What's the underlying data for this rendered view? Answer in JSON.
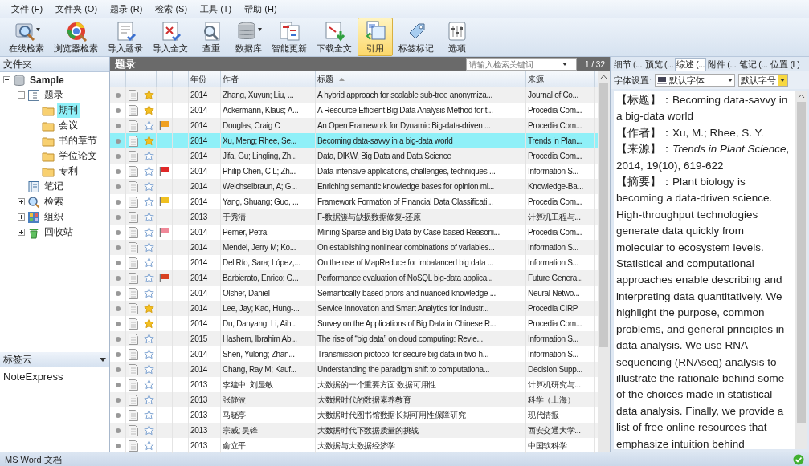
{
  "menu": [
    "文件 (F)",
    "文件夹 (O)",
    "题录 (R)",
    "检索 (S)",
    "工具 (T)",
    "帮助 (H)"
  ],
  "toolbar": [
    {
      "label": "在线检索",
      "has_menu": true,
      "selected": false
    },
    {
      "label": "浏览器检索",
      "has_menu": false,
      "selected": false
    },
    {
      "label": "导入题录",
      "has_menu": false,
      "selected": false
    },
    {
      "label": "导入全文",
      "has_menu": false,
      "selected": false
    },
    {
      "label": "查重",
      "has_menu": false,
      "selected": false
    },
    {
      "label": "数据库",
      "has_menu": true,
      "selected": false
    },
    {
      "label": "智能更新",
      "has_menu": false,
      "selected": false
    },
    {
      "label": "下载全文",
      "has_menu": false,
      "selected": false
    },
    {
      "label": "引用",
      "has_menu": false,
      "selected": true
    },
    {
      "label": "标签标记",
      "has_menu": false,
      "selected": false
    },
    {
      "label": "选项",
      "has_menu": false,
      "selected": false
    }
  ],
  "folders": {
    "title": "文件夹",
    "tree": [
      {
        "label": "Sample",
        "kind": "library",
        "expanded": true,
        "selected": false,
        "children": [
          {
            "label": "题录",
            "kind": "records",
            "expanded": true,
            "selected": false,
            "children": [
              {
                "label": "期刊",
                "kind": "folder",
                "selected": true
              },
              {
                "label": "会议",
                "kind": "folder",
                "selected": false
              },
              {
                "label": "书的章节",
                "kind": "folder",
                "selected": false
              },
              {
                "label": "学位论文",
                "kind": "folder",
                "selected": false
              },
              {
                "label": "专利",
                "kind": "folder",
                "selected": false
              }
            ]
          },
          {
            "label": "笔记",
            "kind": "notes",
            "selected": false
          },
          {
            "label": "检索",
            "kind": "search",
            "expanded": false,
            "selected": false
          },
          {
            "label": "组织",
            "kind": "organize",
            "expanded": false,
            "selected": false
          },
          {
            "label": "回收站",
            "kind": "trash",
            "expanded": false,
            "selected": false
          }
        ]
      }
    ]
  },
  "tag_cloud": {
    "title": "标签云",
    "tags": [
      "NoteExpress"
    ]
  },
  "records": {
    "title": "题录",
    "search": {
      "placeholder": "请输入检索关键词"
    },
    "counter": "1 / 32",
    "columns": [
      {
        "label": "年份",
        "sorted": false
      },
      {
        "label": "作者",
        "sorted": false
      },
      {
        "label": "标题",
        "sorted": true
      },
      {
        "label": "来源",
        "sorted": false
      }
    ],
    "rows": [
      {
        "year": "2014",
        "author": "Zhang, Xuyun; Liu, ...",
        "title": "A hybrid approach for scalable sub-tree anonymiza...",
        "source": "Journal of Co...",
        "starred": true,
        "selected": false
      },
      {
        "year": "2014",
        "author": "Ackermann, Klaus; A...",
        "title": "A Resource Efficient Big Data Analysis Method for t...",
        "source": "Procedia Com...",
        "starred": true,
        "selected": false
      },
      {
        "year": "2014",
        "author": "Douglas, Craig C",
        "title": "An Open Framework for Dynamic Big-data-driven ...",
        "source": "Procedia Com...",
        "starred": false,
        "selected": false,
        "color": "#f0a020"
      },
      {
        "year": "2014",
        "author": "Xu, Meng; Rhee, Se...",
        "title": "Becoming data-savvy in a big-data world",
        "source": "Trends in Plan...",
        "starred": true,
        "selected": true
      },
      {
        "year": "2014",
        "author": "Jifa, Gu; Lingling, Zh...",
        "title": "Data, DIKW, Big Data and Data Science",
        "source": "Procedia Com...",
        "starred": false,
        "selected": false
      },
      {
        "year": "2014",
        "author": "Philip Chen, C L; Zh...",
        "title": "Data-intensive applications, challenges, techniques ...",
        "source": "Information S...",
        "starred": false,
        "selected": false,
        "color": "#e02828"
      },
      {
        "year": "2014",
        "author": "Weichselbraun, A; G...",
        "title": "Enriching semantic knowledge bases for opinion mi...",
        "source": "Knowledge-Ba...",
        "starred": false,
        "selected": false
      },
      {
        "year": "2014",
        "author": "Yang, Shuang; Guo, ...",
        "title": "Framework Formation of Financial Data Classificati...",
        "source": "Procedia Com...",
        "starred": false,
        "selected": false,
        "color": "#f0c020"
      },
      {
        "year": "2013",
        "author": "于秀清",
        "title": "F-数据簇与缺损数据修复-还原",
        "source": "计算机工程与...",
        "starred": false,
        "selected": false
      },
      {
        "year": "2014",
        "author": "Perner, Petra",
        "title": "Mining Sparse and Big Data by Case-based Reasoni...",
        "source": "Procedia Com...",
        "starred": false,
        "selected": false,
        "color": "#f08898"
      },
      {
        "year": "2014",
        "author": "Mendel, Jerry M; Ko...",
        "title": "On establishing nonlinear combinations of variables...",
        "source": "Information S...",
        "starred": false,
        "selected": false
      },
      {
        "year": "2014",
        "author": "Del Río, Sara; López,...",
        "title": "On the use of MapReduce for imbalanced big data ...",
        "source": "Information S...",
        "starred": false,
        "selected": false
      },
      {
        "year": "2014",
        "author": "Barbierato, Enrico; G...",
        "title": "Performance evaluation of NoSQL big-data applica...",
        "source": "Future Genera...",
        "starred": false,
        "selected": false,
        "color": "#d84020"
      },
      {
        "year": "2014",
        "author": "Olsher, Daniel",
        "title": "Semantically-based priors and nuanced knowledge ...",
        "source": "Neural Netwo...",
        "starred": false,
        "selected": false
      },
      {
        "year": "2014",
        "author": "Lee, Jay; Kao, Hung-...",
        "title": "Service Innovation and Smart Analytics for Industr...",
        "source": "Procedia CIRP",
        "starred": true,
        "selected": false
      },
      {
        "year": "2014",
        "author": "Du, Danyang; Li, Aih...",
        "title": "Survey on the Applications of Big Data in Chinese R...",
        "source": "Procedia Com...",
        "starred": true,
        "selected": false
      },
      {
        "year": "2015",
        "author": "Hashem, Ibrahim Ab...",
        "title": "The rise of “big data” on cloud computing: Revie...",
        "source": "Information S...",
        "starred": false,
        "selected": false
      },
      {
        "year": "2014",
        "author": "Shen, Yulong; Zhan...",
        "title": "Transmission protocol for secure big data in two-h...",
        "source": "Information S...",
        "starred": false,
        "selected": false
      },
      {
        "year": "2014",
        "author": "Chang, Ray M; Kauf...",
        "title": "Understanding the paradigm shift to computationa...",
        "source": "Decision Supp...",
        "starred": false,
        "selected": false
      },
      {
        "year": "2013",
        "author": "李建中; 刘显敏",
        "title": "大数据的一个重要方面:数据可用性",
        "source": "计算机研究与...",
        "starred": false,
        "selected": false
      },
      {
        "year": "2013",
        "author": "张静波",
        "title": "大数据时代的数据素养教育",
        "source": "科学（上海）",
        "starred": false,
        "selected": false
      },
      {
        "year": "2013",
        "author": "马晓亭",
        "title": "大数据时代图书馆数据长期可用性保障研究",
        "source": "现代情报",
        "starred": false,
        "selected": false
      },
      {
        "year": "2013",
        "author": "宗威; 吴锋",
        "title": "大数据时代下数据质量的挑战",
        "source": "西安交通大学...",
        "starred": false,
        "selected": false
      },
      {
        "year": "2013",
        "author": "俞立平",
        "title": "大数据与大数据经济学",
        "source": "中国软科学",
        "starred": false,
        "selected": false
      }
    ]
  },
  "details": {
    "tabs": [
      {
        "label": "细节 (...",
        "selected": false
      },
      {
        "label": "预览 (...",
        "selected": false
      },
      {
        "label": "综述 (...",
        "selected": true
      },
      {
        "label": "附件 (...",
        "selected": false
      },
      {
        "label": "笔记 (...",
        "selected": false
      },
      {
        "label": "位置 (L)",
        "selected": false
      }
    ],
    "font_label": "字体设置:",
    "font": "默认字体",
    "font_size": "默认字号",
    "paragraphs": [
      "【标题】：Becoming data-savvy in a big-data world",
      "【作者】：Xu, M.; Rhee, S. Y.",
      "【来源】：*Trends in Plant Science*, 2014, 19(10), 619-622",
      "【摘要】：Plant biology is becoming a data-driven science. High-throughput technologies generate data quickly from molecular to ecosystem levels. Statistical and computational approaches enable describing and interpreting data quantitatively. We highlight the purpose, common problems, and general principles in data analysis. We use RNA sequencing (RNAseq) analysis to illustrate the rationale behind some of the choices made in statistical data analysis. Finally, we provide a list of free online resources that emphasize intuition behind"
    ]
  },
  "status_bar": {
    "text": "MS Word 文档"
  }
}
